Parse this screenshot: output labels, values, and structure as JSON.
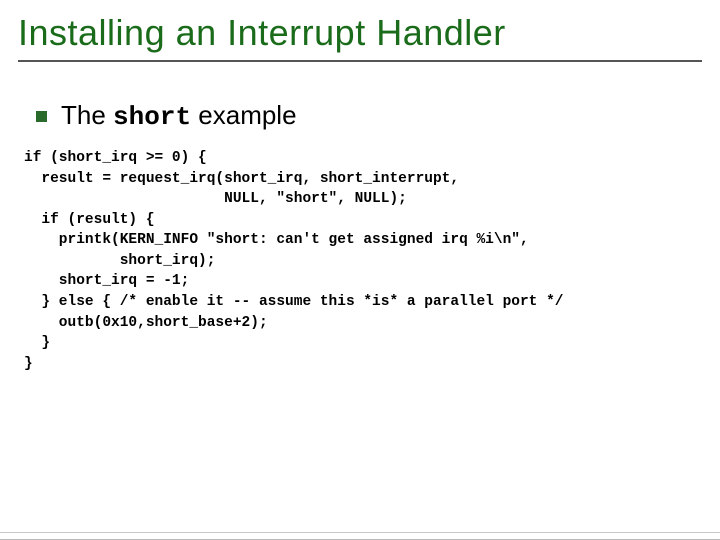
{
  "title": "Installing an Interrupt Handler",
  "bullet": {
    "prefix": "The ",
    "mono": "short",
    "suffix": " example"
  },
  "code": "if (short_irq >= 0) {\n  result = request_irq(short_irq, short_interrupt,\n                       NULL, \"short\", NULL);\n  if (result) {\n    printk(KERN_INFO \"short: can't get assigned irq %i\\n\",\n           short_irq);\n    short_irq = -1;\n  } else { /* enable it -- assume this *is* a parallel port */\n    outb(0x10,short_base+2);\n  }\n}"
}
